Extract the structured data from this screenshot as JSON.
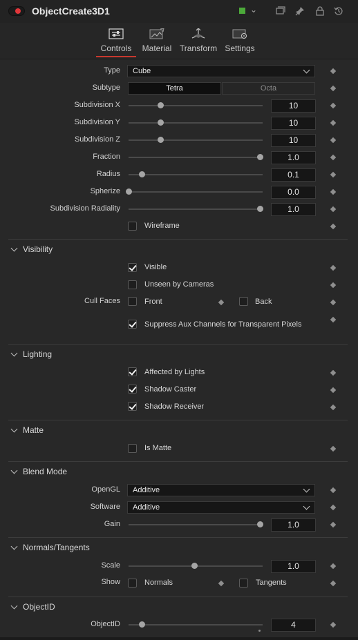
{
  "header": {
    "title": "ObjectCreate3D1",
    "icons": [
      "power-toggle",
      "green-color-swatch",
      "chevron-down-icon",
      "windows-icon",
      "pin-icon",
      "lock-icon",
      "reset-icon"
    ]
  },
  "tabs": [
    {
      "label": "Controls",
      "icon": "controls-icon",
      "active": true
    },
    {
      "label": "Material",
      "icon": "material-icon",
      "active": false
    },
    {
      "label": "Transform",
      "icon": "transform-icon",
      "active": false
    },
    {
      "label": "Settings",
      "icon": "settings-icon",
      "active": false
    }
  ],
  "controls": {
    "type": {
      "label": "Type",
      "value": "Cube"
    },
    "subtype": {
      "label": "Subtype",
      "options": [
        "Tetra",
        "Octa"
      ],
      "selected": "Tetra"
    },
    "sliders": [
      {
        "label": "Subdivision X",
        "value": "10",
        "level": 0.24
      },
      {
        "label": "Subdivision Y",
        "value": "10",
        "level": 0.24
      },
      {
        "label": "Subdivision Z",
        "value": "10",
        "level": 0.24
      },
      {
        "label": "Fraction",
        "value": "1.0",
        "level": 1.0
      },
      {
        "label": "Radius",
        "value": "0.1",
        "level": 0.1
      },
      {
        "label": "Spherize",
        "value": "0.0",
        "level": 0.0
      },
      {
        "label": "Subdivision Radiality",
        "value": "1.0",
        "level": 1.0
      }
    ],
    "wireframe": {
      "label": "Wireframe",
      "checked": false
    }
  },
  "visibility": {
    "title": "Visibility",
    "visible": {
      "label": "Visible",
      "checked": true
    },
    "unseen": {
      "label": "Unseen by Cameras",
      "checked": false
    },
    "cull_faces": {
      "label": "Cull Faces",
      "front": "Front",
      "back": "Back"
    },
    "suppress": {
      "label": "Suppress Aux Channels for Transparent Pixels",
      "checked": true
    }
  },
  "lighting": {
    "title": "Lighting",
    "items": [
      {
        "label": "Affected by Lights",
        "checked": true
      },
      {
        "label": "Shadow Caster",
        "checked": true
      },
      {
        "label": "Shadow Receiver",
        "checked": true
      }
    ]
  },
  "matte": {
    "title": "Matte",
    "is_matte": {
      "label": "Is Matte",
      "checked": false
    }
  },
  "blend_mode": {
    "title": "Blend Mode",
    "opengl": {
      "label": "OpenGL",
      "value": "Additive"
    },
    "software": {
      "label": "Software",
      "value": "Additive"
    },
    "gain": {
      "label": "Gain",
      "value": "1.0",
      "level": 1.0
    }
  },
  "normals_tangents": {
    "title": "Normals/Tangents",
    "scale": {
      "label": "Scale",
      "value": "1.0",
      "level": 0.5
    },
    "show": {
      "label": "Show",
      "normals": "Normals",
      "tangents": "Tangents"
    }
  },
  "object_id": {
    "title": "ObjectID",
    "field": {
      "label": "ObjectID",
      "value": "4",
      "level": 0.1
    }
  },
  "colors": {
    "accent": "#c8382e",
    "power": "#e0363a",
    "swatch": "#4caa3a"
  }
}
